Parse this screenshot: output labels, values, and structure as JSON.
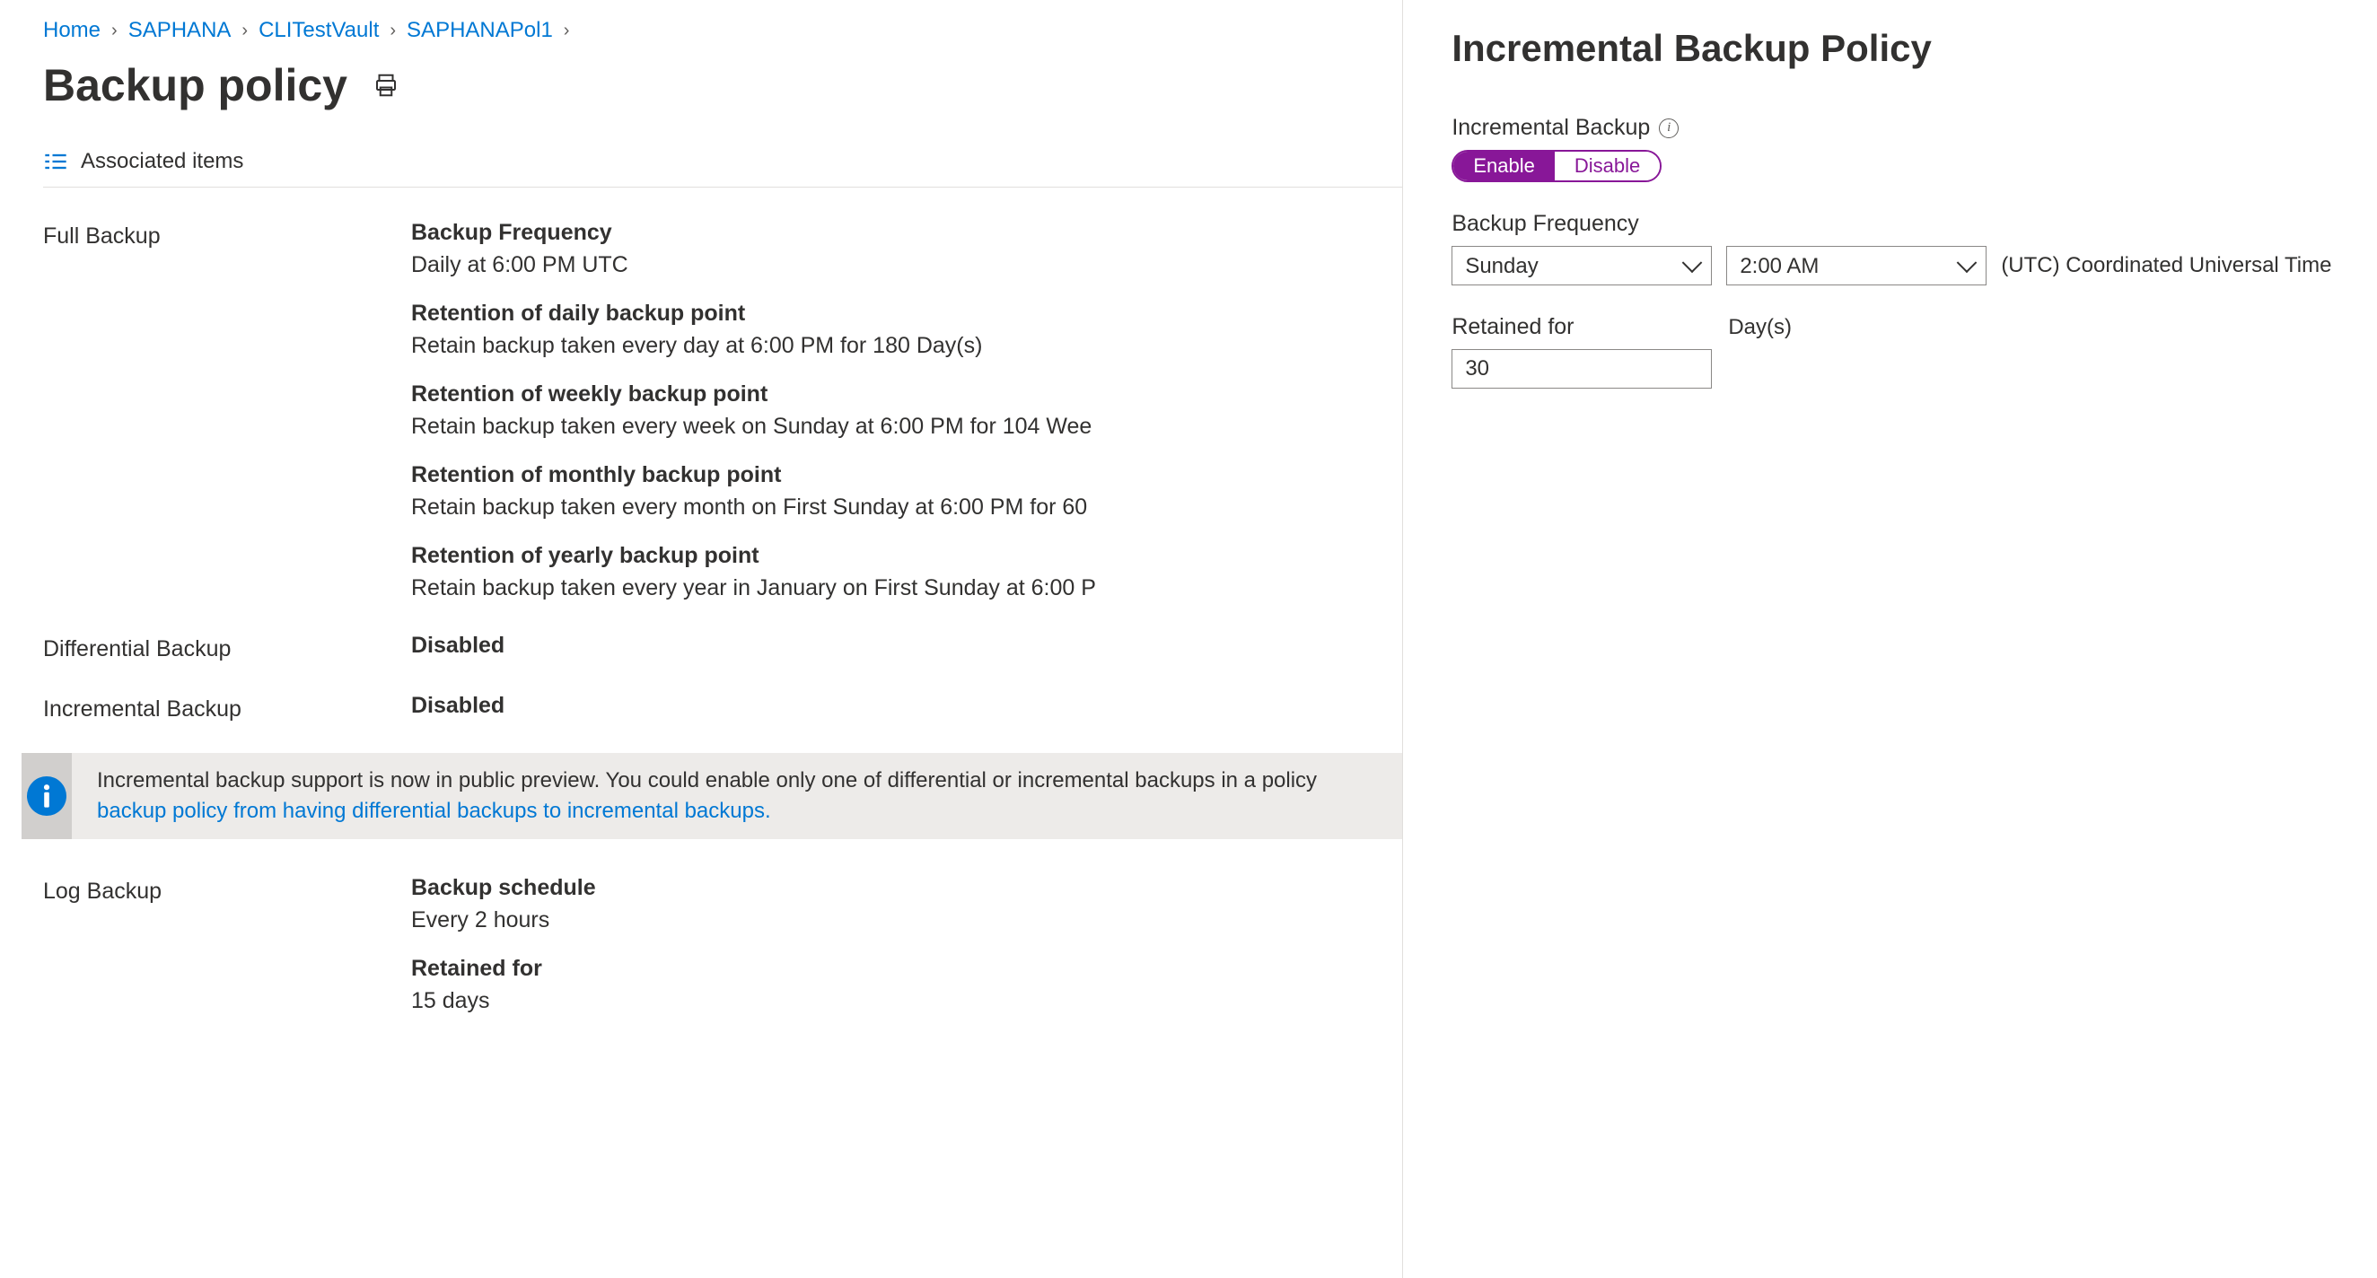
{
  "breadcrumb": {
    "items": [
      "Home",
      "SAPHANA",
      "CLITestVault",
      "SAPHANAPol1"
    ]
  },
  "page": {
    "title": "Backup policy"
  },
  "tabs": {
    "associated": "Associated items"
  },
  "full_backup": {
    "label": "Full Backup",
    "frequency": {
      "k": "Backup Frequency",
      "v": "Daily at 6:00 PM UTC"
    },
    "daily": {
      "k": "Retention of daily backup point",
      "v": "Retain backup taken every day at 6:00 PM for 180 Day(s)"
    },
    "weekly": {
      "k": "Retention of weekly backup point",
      "v": "Retain backup taken every week on Sunday at 6:00 PM for 104 Wee"
    },
    "monthly": {
      "k": "Retention of monthly backup point",
      "v": "Retain backup taken every month on First Sunday at 6:00 PM for 60"
    },
    "yearly": {
      "k": "Retention of yearly backup point",
      "v": "Retain backup taken every year in January on First Sunday at 6:00 P"
    }
  },
  "diff_backup": {
    "label": "Differential Backup",
    "value": "Disabled"
  },
  "incr_backup": {
    "label": "Incremental Backup",
    "value": "Disabled"
  },
  "info": {
    "text1": "Incremental backup support is now in public preview. You could enable only one of differential or incremental backups in a policy",
    "link": "backup policy from having differential backups to incremental backups."
  },
  "log_backup": {
    "label": "Log Backup",
    "schedule": {
      "k": "Backup schedule",
      "v": "Every 2 hours"
    },
    "retain": {
      "k": "Retained for",
      "v": "15 days"
    }
  },
  "panel": {
    "title": "Incremental Backup Policy",
    "incremental_label": "Incremental Backup",
    "enable": "Enable",
    "disable": "Disable",
    "freq_label": "Backup Frequency",
    "day": "Sunday",
    "time": "2:00 AM",
    "tz": "(UTC) Coordinated Universal Time",
    "retain_label": "Retained for",
    "retain_value": "30",
    "retain_unit": "Day(s)"
  }
}
